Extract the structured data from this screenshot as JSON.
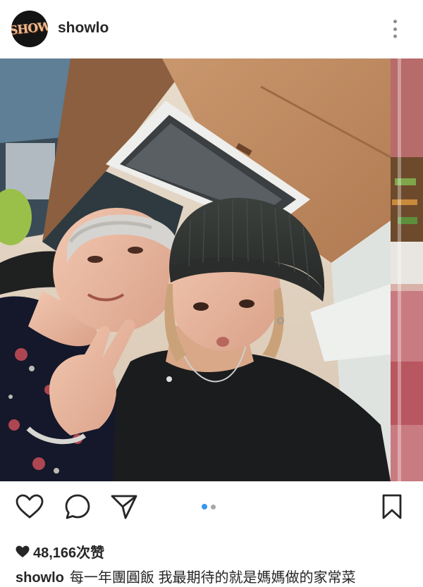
{
  "header": {
    "avatar_text": "SHOW",
    "username": "showlo",
    "more_icon": "more-vertical-icon"
  },
  "photo": {
    "description_icon": "photo",
    "carousel_total": 2,
    "carousel_current": 1
  },
  "actions": {
    "like_icon": "heart-outline-icon",
    "comment_icon": "comment-bubble-icon",
    "share_icon": "paper-plane-icon",
    "save_icon": "bookmark-icon"
  },
  "likes": {
    "icon": "heart-filled-icon",
    "text": "48,166次赞"
  },
  "caption": {
    "username": "showlo",
    "text": "每一年團圓飯 我最期待的就是媽媽做的家常菜"
  },
  "colors": {
    "accent_blue": "#3897f0",
    "text_dark": "#262626",
    "icon_gray": "#8e8e8e"
  }
}
